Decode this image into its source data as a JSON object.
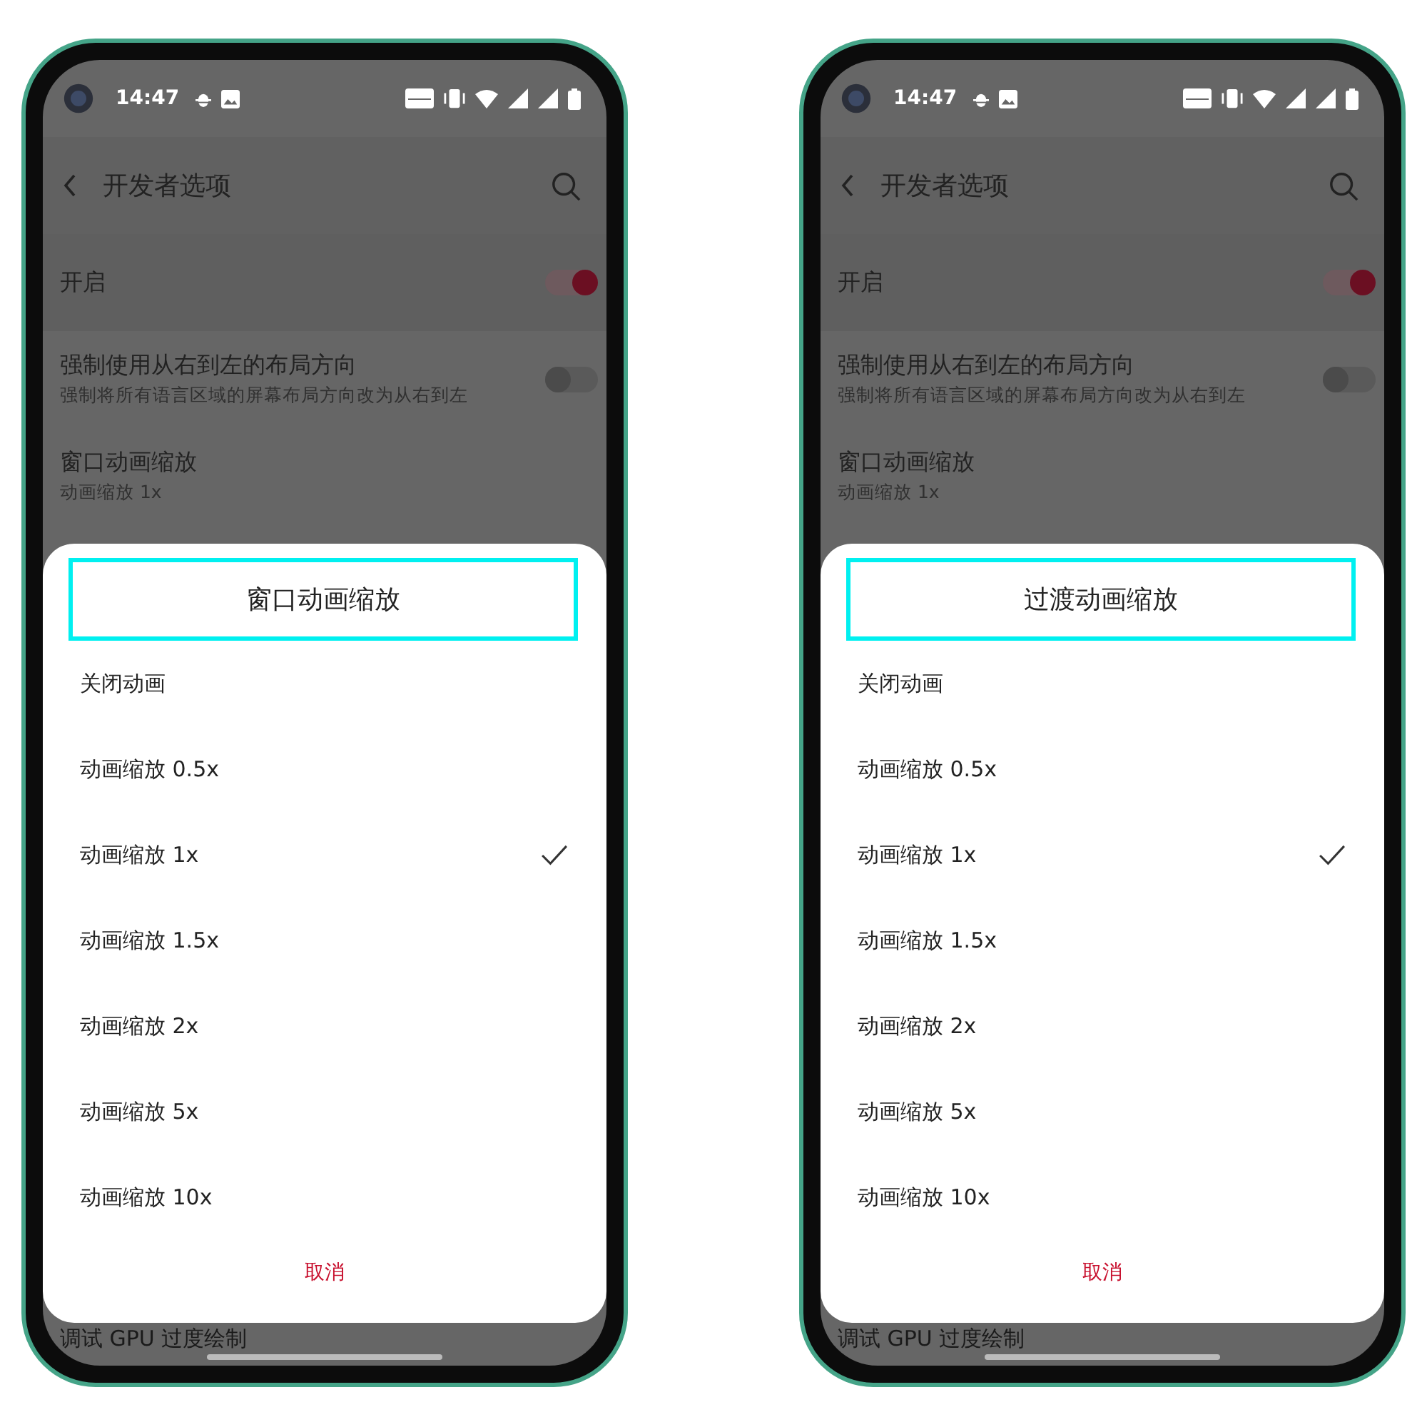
{
  "phones": [
    {
      "status_bar": {
        "time": "14:47"
      },
      "header": {
        "title": "开发者选项"
      },
      "settings": [
        {
          "kind": "toggle",
          "title": "开启",
          "on": true
        },
        {
          "kind": "toggle",
          "title": "强制使用从右到左的布局方向",
          "subtitle": "强制将所有语言区域的屏幕布局方向改为从右到左",
          "on": false
        },
        {
          "kind": "value",
          "title": "窗口动画缩放",
          "subtitle": "动画缩放 1x"
        }
      ],
      "dialog": {
        "title": "窗口动画缩放",
        "options": [
          {
            "label": "关闭动画",
            "selected": false
          },
          {
            "label": "动画缩放 0.5x",
            "selected": false
          },
          {
            "label": "动画缩放 1x",
            "selected": true
          },
          {
            "label": "动画缩放 1.5x",
            "selected": false
          },
          {
            "label": "动画缩放 2x",
            "selected": false
          },
          {
            "label": "动画缩放 5x",
            "selected": false
          },
          {
            "label": "动画缩放 10x",
            "selected": false
          }
        ],
        "cancel": "取消"
      },
      "footer_item": "调试 GPU 过度绘制"
    },
    {
      "status_bar": {
        "time": "14:47"
      },
      "header": {
        "title": "开发者选项"
      },
      "settings": [
        {
          "kind": "toggle",
          "title": "开启",
          "on": true
        },
        {
          "kind": "toggle",
          "title": "强制使用从右到左的布局方向",
          "subtitle": "强制将所有语言区域的屏幕布局方向改为从右到左",
          "on": false
        },
        {
          "kind": "value",
          "title": "窗口动画缩放",
          "subtitle": "动画缩放 1x"
        }
      ],
      "dialog": {
        "title": "过渡动画缩放",
        "options": [
          {
            "label": "关闭动画",
            "selected": false
          },
          {
            "label": "动画缩放 0.5x",
            "selected": false
          },
          {
            "label": "动画缩放 1x",
            "selected": true
          },
          {
            "label": "动画缩放 1.5x",
            "selected": false
          },
          {
            "label": "动画缩放 2x",
            "selected": false
          },
          {
            "label": "动画缩放 5x",
            "selected": false
          },
          {
            "label": "动画缩放 10x",
            "selected": false
          }
        ],
        "cancel": "取消"
      },
      "footer_item": "调试 GPU 过度绘制"
    }
  ]
}
